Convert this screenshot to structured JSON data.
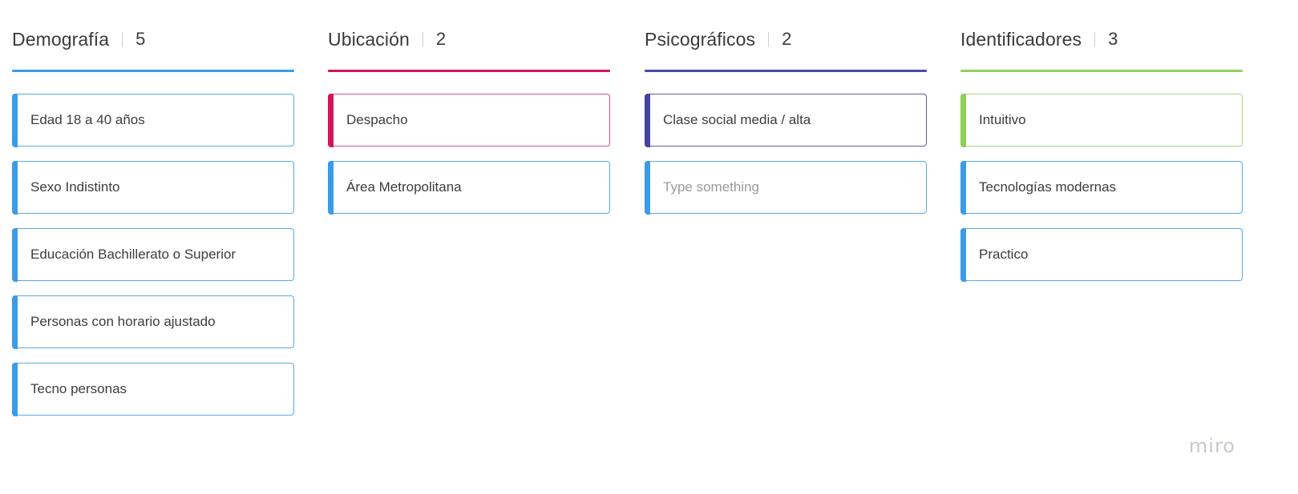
{
  "columns": [
    {
      "title": "Demografía",
      "count": "5",
      "color": "#3d9be6",
      "cards": [
        {
          "text": "Edad 18 a 40 años",
          "accent": "#3d9be6",
          "border": "#5ba8e4",
          "placeholder": false
        },
        {
          "text": "Sexo Indistinto",
          "accent": "#3d9be6",
          "border": "#5ba8e4",
          "placeholder": false
        },
        {
          "text": "Educación Bachillerato o Superior",
          "accent": "#3d9be6",
          "border": "#5ba8e4",
          "placeholder": false
        },
        {
          "text": "Personas con horario ajustado",
          "accent": "#3d9be6",
          "border": "#5ba8e4",
          "placeholder": false
        },
        {
          "text": "Tecno personas",
          "accent": "#3d9be6",
          "border": "#5ba8e4",
          "placeholder": false
        }
      ]
    },
    {
      "title": "Ubicación",
      "count": "2",
      "color": "#d0165e",
      "cards": [
        {
          "text": "Despacho",
          "accent": "#d0165e",
          "border": "#d64f85",
          "placeholder": false
        },
        {
          "text": "Área Metropolitana",
          "accent": "#3d9be6",
          "border": "#5ba8e4",
          "placeholder": false
        }
      ]
    },
    {
      "title": "Psicográficos",
      "count": "2",
      "color": "#4a4aa8",
      "cards": [
        {
          "text": "Clase social media / alta",
          "accent": "#45449e",
          "border": "#5d5cae",
          "placeholder": false
        },
        {
          "text": "Type something",
          "accent": "#3d9be6",
          "border": "#5ba8e4",
          "placeholder": true
        }
      ]
    },
    {
      "title": "Identificadores",
      "count": "3",
      "color": "#93cf5f",
      "cards": [
        {
          "text": "Intuitivo",
          "accent": "#8fcf58",
          "border": "#a9d987",
          "placeholder": false
        },
        {
          "text": "Tecnologías modernas",
          "accent": "#3d9be6",
          "border": "#5ba8e4",
          "placeholder": false
        },
        {
          "text": "Practico",
          "accent": "#3d9be6",
          "border": "#5ba8e4",
          "placeholder": false
        }
      ]
    }
  ],
  "watermark": "miro"
}
